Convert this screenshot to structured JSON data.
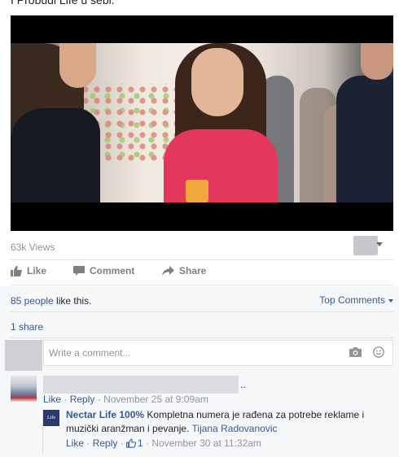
{
  "post": {
    "text": "I Probudi Life u sebi.",
    "video_views": "63k Views"
  },
  "actions": {
    "like": "Like",
    "comment": "Comment",
    "share": "Share"
  },
  "summary": {
    "likes_link": "85 people",
    "likes_suffix": " like this.",
    "top_comments": "Top Comments",
    "shares": "1 share"
  },
  "comment_box": {
    "placeholder": "Write a comment..."
  },
  "comments": [
    {
      "name_suffix": "..",
      "like": "Like",
      "reply": "Reply",
      "timestamp": "November 25 at 9:09am",
      "replies": [
        {
          "author": "Nectar Life 100%",
          "text": "Kompletna numera je rađena za potrebe reklame i muzički aranžman i pevanje.",
          "mention": "Tijana Radovanovic",
          "like": "Like",
          "reply": "Reply",
          "like_count": "1",
          "timestamp": "November 30 at 11:32am",
          "avatar_text": "Life"
        }
      ]
    }
  ],
  "icons": {
    "like": "thumbs-up-icon",
    "comment": "speech-bubble-icon",
    "share": "share-arrow-icon",
    "camera": "camera-icon",
    "emoji": "smiley-icon"
  },
  "colors": {
    "link": "#365899",
    "muted": "#90949c",
    "action": "#7f7f7f",
    "summary_bg": "#f6f7f9"
  }
}
